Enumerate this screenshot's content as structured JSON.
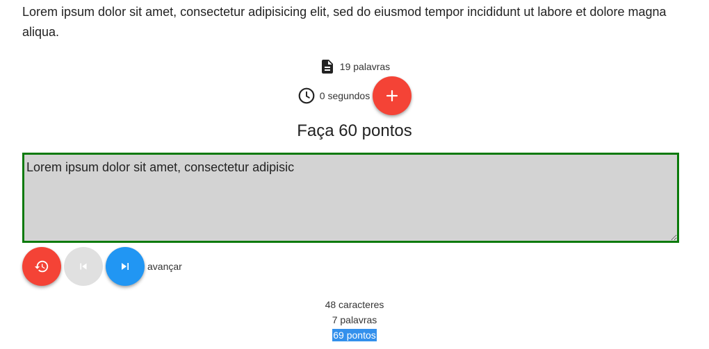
{
  "prompt": {
    "text": "Lorem ipsum dolor sit amet, consectetur adipisicing elit, sed do eiusmod tempor incididunt ut labore et dolore magna aliqua."
  },
  "stats": {
    "words_label": "19 palavras",
    "time_label": "0 segundos"
  },
  "goal": {
    "title": "Faça 60 pontos"
  },
  "editor": {
    "value": "Lorem ipsum dolor sit amet, consectetur adipisic"
  },
  "controls": {
    "advance_label": "avançar"
  },
  "results": {
    "characters": "48 caracteres",
    "words": "7 palavras",
    "points": "69 pontos"
  },
  "colors": {
    "red": "#f44336",
    "blue": "#2196f3",
    "grey": "#e0e0e0",
    "editor_border": "#0b7a0b",
    "editor_bg": "#d3d3d3",
    "highlight": "#3390ec"
  },
  "icons": {
    "words": "document-icon",
    "time": "clock-icon",
    "add": "plus-icon",
    "restart": "history-icon",
    "previous": "skip-previous-icon",
    "next": "skip-next-icon"
  }
}
